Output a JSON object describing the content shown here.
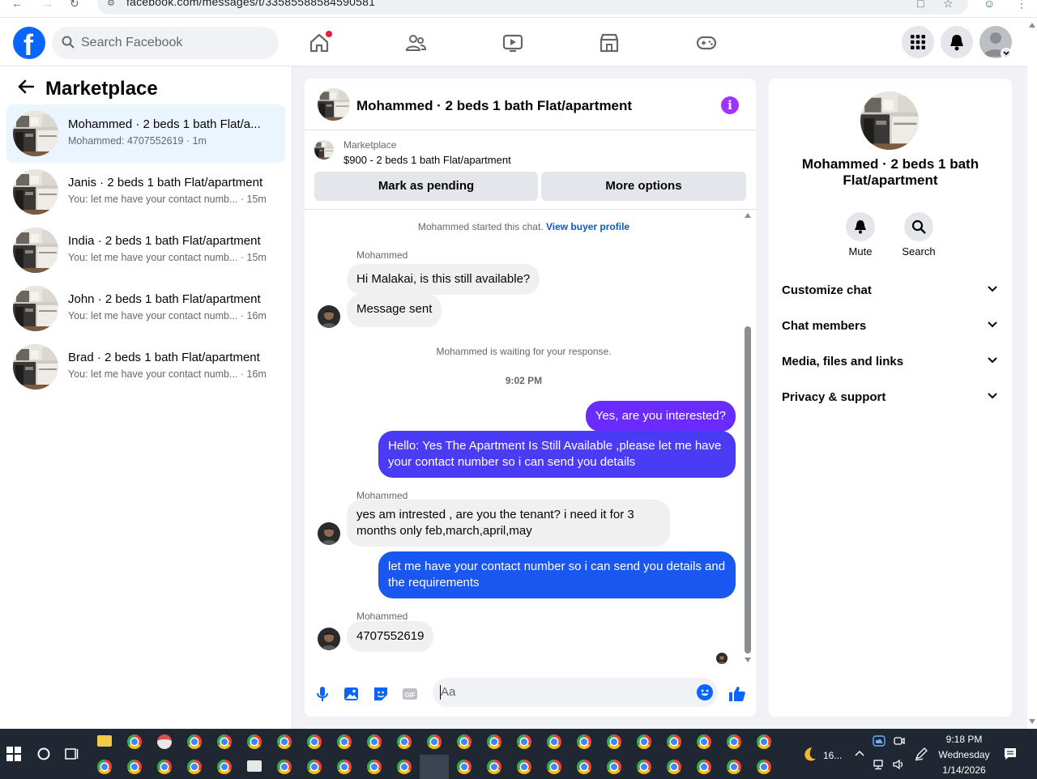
{
  "browser": {
    "url": "facebook.com/messages/t/33585588584590581"
  },
  "header": {
    "search_placeholder": "Search Facebook"
  },
  "left": {
    "title": "Marketplace",
    "conversations": [
      {
        "name": "Mohammed · 2 beds 1 bath Flat/a...",
        "sub": "Mohammed: 4707552619 · 1m",
        "active": true
      },
      {
        "name": "Janis · 2 beds 1 bath Flat/apartment",
        "sub": "You: let me have your contact numb... · 15m"
      },
      {
        "name": "India · 2 beds 1 bath Flat/apartment",
        "sub": "You: let me have your contact numb... · 15m"
      },
      {
        "name": "John · 2 beds 1 bath Flat/apartment",
        "sub": "You: let me have your contact numb... · 16m"
      },
      {
        "name": "Brad · 2 beds 1 bath Flat/apartment",
        "sub": "You: let me have your contact numb... · 16m"
      }
    ]
  },
  "chat": {
    "title": "Mohammed · 2 beds 1 bath Flat/apartment",
    "listing_source": "Marketplace",
    "listing_title": "$900 - 2 beds 1 bath Flat/apartment",
    "mark_pending": "Mark as pending",
    "more_options": "More options",
    "started_text": "Mohammed started this chat.",
    "view_profile": "View buyer profile",
    "sender": "Mohammed",
    "msg1": "Hi Malakai, is this still available?",
    "msg2": "Message sent",
    "waiting": "Mohammed is waiting for your response.",
    "time": "9:02 PM",
    "out1": "Yes, are you interested?",
    "out2_line1": "Hello: Yes The Apartment Is Still Available ,please let me have",
    "out2_line2": "your contact number so i can send you details",
    "msg3_line1": "yes am intrested , are you the tenant? i need it for 3",
    "msg3_line2": "months only feb,march,april,may",
    "out3_line1": "let me have your contact number so i can send you details and",
    "out3_line2": "the requirements",
    "msg4": "4707552619",
    "composer_placeholder": "Aa"
  },
  "right": {
    "title": "Mohammed · 2 beds 1 bath Flat/apartment",
    "mute": "Mute",
    "search": "Search",
    "items": [
      "Customize chat",
      "Chat members",
      "Media, files and links",
      "Privacy & support"
    ]
  },
  "taskbar": {
    "weather": "16...",
    "time": "9:18 PM",
    "day": "Wednesday",
    "date": "1/14/2026"
  },
  "colors": {
    "brand": "#0866ff",
    "outgoing_purple": "#6a2bff",
    "outgoing_blue": "#1a57f0",
    "info_purple": "#a033ff"
  }
}
